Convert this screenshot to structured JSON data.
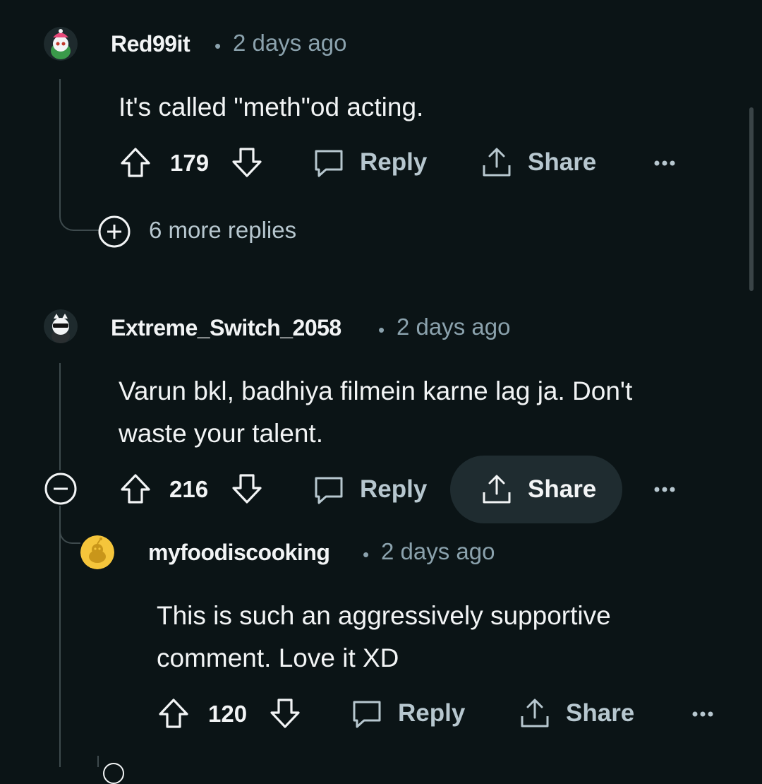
{
  "comments": [
    {
      "username": "Red99it",
      "separator": "•",
      "time": "2 days ago",
      "body": "It's called \"meth\"od acting.",
      "score": "179",
      "reply_label": "Reply",
      "share_label": "Share",
      "more_replies": "6 more replies"
    },
    {
      "username": "Extreme_Switch_2058",
      "separator": "•",
      "time": "2 days ago",
      "body_lines": [
        "Varun bkl, badhiya filmein karne lag ja. Don't",
        "waste your talent."
      ],
      "score": "216",
      "reply_label": "Reply",
      "share_label": "Share"
    },
    {
      "username": "myfoodiscooking",
      "separator": "•",
      "time": "2 days ago",
      "body_lines": [
        "This is such an aggressively supportive",
        "comment. Love it XD"
      ],
      "score": "120",
      "reply_label": "Reply",
      "share_label": "Share"
    }
  ],
  "colors": {
    "background": "#0b1416",
    "text": "#f2f4f5",
    "muted": "#8ba2ad",
    "active_button": "#1f2c30",
    "avatar_yellow": "#f5c53b"
  },
  "icons": [
    "upvote-icon",
    "downvote-icon",
    "comment-bubble-icon",
    "share-upload-icon",
    "more-dots-icon",
    "expand-plus-icon",
    "collapse-minus-icon"
  ]
}
